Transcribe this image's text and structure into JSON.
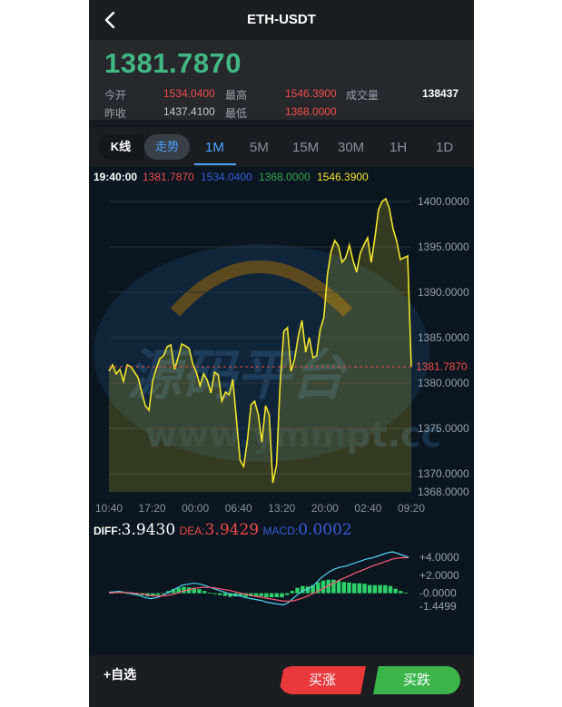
{
  "header": {
    "title": "ETH-USDT"
  },
  "quote": {
    "price": "1381.7870",
    "open_label": "今开",
    "open": "1534.0400",
    "high_label": "最高",
    "high": "1546.3900",
    "volume_label": "成交量",
    "volume": "138437",
    "prev_close_label": "昨收",
    "prev_close": "1437.4100",
    "low_label": "最低",
    "low": "1368.0000"
  },
  "tabs": {
    "kline": "K线",
    "trend": "走势",
    "intervals": [
      "1M",
      "5M",
      "15M",
      "30M",
      "1H",
      "1D"
    ],
    "active": "1M"
  },
  "legend": {
    "time": "19:40:00",
    "v1": "1381.7870",
    "v2": "1534.0400",
    "v3": "1368.0000",
    "v4": "1546.3900"
  },
  "watermark": {
    "text": "源码平台",
    "url": "www.ymmpt.cc"
  },
  "chart_data": [
    {
      "type": "area",
      "x": [
        "10:40",
        "17:20",
        "00:00",
        "06:40",
        "13:20",
        "20:00",
        "02:40",
        "09:20"
      ],
      "y_ticks": [
        "1400.0000",
        "1395.0000",
        "1390.0000",
        "1385.0000",
        "1380.0000",
        "1375.0000",
        "1370.0000",
        "1368.0000"
      ],
      "ylim": [
        1368,
        1401
      ],
      "current_price_label": "1381.7870",
      "current_price": 1381.787,
      "values": [
        1381.3,
        1382.0,
        1381.0,
        1381.5,
        1380.2,
        1382.0,
        1381.8,
        1381.2,
        1380.6,
        1379.0,
        1377.5,
        1377.0,
        1380.2,
        1381.6,
        1382.7,
        1383.0,
        1384.0,
        1384.2,
        1381.5,
        1382.8,
        1384.3,
        1384.1,
        1383.8,
        1382.1,
        1381.2,
        1379.7,
        1381.0,
        1380.3,
        1378.9,
        1381.2,
        1380.9,
        1378.0,
        1379.0,
        1378.7,
        1380.4,
        1376.0,
        1371.5,
        1370.8,
        1373.7,
        1377.6,
        1378.0,
        1376.5,
        1373.5,
        1377.5,
        1376.5,
        1369.0,
        1371.0,
        1380.0,
        1385.7,
        1386.1,
        1381.3,
        1382.7,
        1385.2,
        1386.9,
        1383.4,
        1385.0,
        1382.8,
        1383.0,
        1385.9,
        1387.2,
        1392.0,
        1394.5,
        1395.7,
        1395.1,
        1393.3,
        1393.8,
        1395.2,
        1393.5,
        1392.2,
        1394.3,
        1395.2,
        1396.0,
        1393.3,
        1396.0,
        1399.1,
        1400.0,
        1400.3,
        1399.2,
        1397.0,
        1395.6,
        1393.6,
        1393.8,
        1394.0,
        1381.8
      ]
    },
    {
      "type": "line",
      "title": "MACD",
      "diff_label": "DIFF:",
      "diff": "3.9430",
      "dea_label": "DEA:",
      "dea": "3.9429",
      "macd_label": "MACD:",
      "macd": "0.0002",
      "y_ticks": [
        "+4.0000",
        "+2.0000",
        "-0.0000",
        "-1.4499"
      ],
      "ylim": [
        -1.4499,
        4.6
      ],
      "series": [
        {
          "name": "DIFF",
          "color": "#4fd3f0",
          "values": [
            0.1,
            0.15,
            0.2,
            0.1,
            -0.05,
            -0.15,
            -0.3,
            -0.5,
            -0.6,
            -0.5,
            -0.3,
            0.0,
            0.3,
            0.6,
            0.9,
            1.0,
            1.1,
            1.05,
            0.9,
            0.7,
            0.5,
            0.3,
            0.1,
            -0.1,
            -0.2,
            -0.3,
            -0.5,
            -0.6,
            -0.7,
            -0.8,
            -1.0,
            -1.1,
            -1.2,
            -1.3,
            -1.1,
            -0.6,
            -0.1,
            0.3,
            0.5,
            0.9,
            1.5,
            2.0,
            2.4,
            2.7,
            2.9,
            3.0,
            3.2,
            3.4,
            3.6,
            3.8,
            3.9,
            4.1,
            4.3,
            4.5,
            4.6,
            4.4,
            4.2,
            4.0
          ]
        },
        {
          "name": "DEA",
          "color": "#ff5a7a",
          "values": [
            0.05,
            0.07,
            0.1,
            0.08,
            0.05,
            0.0,
            -0.07,
            -0.15,
            -0.25,
            -0.3,
            -0.3,
            -0.25,
            -0.15,
            0.0,
            0.2,
            0.35,
            0.5,
            0.6,
            0.65,
            0.65,
            0.6,
            0.5,
            0.4,
            0.3,
            0.15,
            0.0,
            -0.1,
            -0.25,
            -0.35,
            -0.45,
            -0.55,
            -0.65,
            -0.75,
            -0.85,
            -0.9,
            -0.85,
            -0.7,
            -0.5,
            -0.25,
            0.0,
            0.3,
            0.6,
            0.9,
            1.2,
            1.5,
            1.75,
            2.0,
            2.3,
            2.5,
            2.75,
            3.0,
            3.2,
            3.4,
            3.6,
            3.8,
            3.9,
            3.95,
            3.94
          ]
        }
      ],
      "histogram": [
        0.05,
        0.08,
        0.1,
        0.02,
        -0.1,
        -0.15,
        -0.23,
        -0.35,
        -0.35,
        -0.2,
        0.0,
        0.25,
        0.45,
        0.6,
        0.7,
        0.65,
        0.6,
        0.45,
        0.25,
        0.05,
        -0.1,
        -0.2,
        -0.3,
        -0.4,
        -0.35,
        -0.3,
        -0.4,
        -0.35,
        -0.35,
        -0.35,
        -0.45,
        -0.45,
        -0.45,
        -0.45,
        -0.2,
        0.25,
        0.6,
        0.8,
        0.75,
        0.9,
        1.2,
        1.4,
        1.5,
        1.5,
        1.4,
        1.25,
        1.2,
        1.1,
        1.1,
        1.05,
        0.9,
        0.9,
        0.9,
        0.9,
        0.8,
        0.5,
        0.25,
        0.06
      ]
    }
  ],
  "bottom": {
    "watch_label": "+自选",
    "buy_label": "买涨",
    "sell_label": "买跌"
  },
  "colors": {
    "up": "#41b883",
    "down": "#ee4b4b",
    "accent": "#4aa3ff",
    "line": "#f2e62a"
  }
}
